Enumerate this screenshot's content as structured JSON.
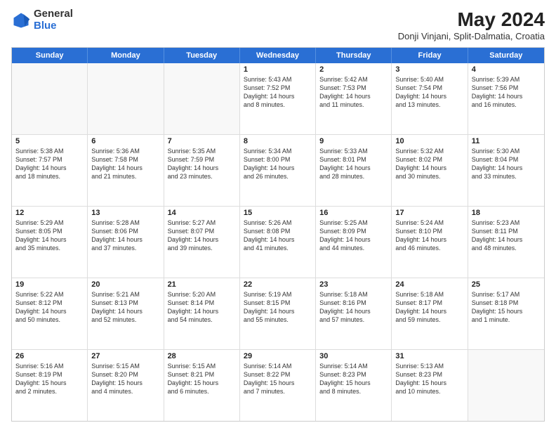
{
  "header": {
    "logo_general": "General",
    "logo_blue": "Blue",
    "month_year": "May 2024",
    "location": "Donji Vinjani, Split-Dalmatia, Croatia"
  },
  "days_of_week": [
    "Sunday",
    "Monday",
    "Tuesday",
    "Wednesday",
    "Thursday",
    "Friday",
    "Saturday"
  ],
  "weeks": [
    [
      {
        "day": "",
        "text": ""
      },
      {
        "day": "",
        "text": ""
      },
      {
        "day": "",
        "text": ""
      },
      {
        "day": "1",
        "text": "Sunrise: 5:43 AM\nSunset: 7:52 PM\nDaylight: 14 hours\nand 8 minutes."
      },
      {
        "day": "2",
        "text": "Sunrise: 5:42 AM\nSunset: 7:53 PM\nDaylight: 14 hours\nand 11 minutes."
      },
      {
        "day": "3",
        "text": "Sunrise: 5:40 AM\nSunset: 7:54 PM\nDaylight: 14 hours\nand 13 minutes."
      },
      {
        "day": "4",
        "text": "Sunrise: 5:39 AM\nSunset: 7:56 PM\nDaylight: 14 hours\nand 16 minutes."
      }
    ],
    [
      {
        "day": "5",
        "text": "Sunrise: 5:38 AM\nSunset: 7:57 PM\nDaylight: 14 hours\nand 18 minutes."
      },
      {
        "day": "6",
        "text": "Sunrise: 5:36 AM\nSunset: 7:58 PM\nDaylight: 14 hours\nand 21 minutes."
      },
      {
        "day": "7",
        "text": "Sunrise: 5:35 AM\nSunset: 7:59 PM\nDaylight: 14 hours\nand 23 minutes."
      },
      {
        "day": "8",
        "text": "Sunrise: 5:34 AM\nSunset: 8:00 PM\nDaylight: 14 hours\nand 26 minutes."
      },
      {
        "day": "9",
        "text": "Sunrise: 5:33 AM\nSunset: 8:01 PM\nDaylight: 14 hours\nand 28 minutes."
      },
      {
        "day": "10",
        "text": "Sunrise: 5:32 AM\nSunset: 8:02 PM\nDaylight: 14 hours\nand 30 minutes."
      },
      {
        "day": "11",
        "text": "Sunrise: 5:30 AM\nSunset: 8:04 PM\nDaylight: 14 hours\nand 33 minutes."
      }
    ],
    [
      {
        "day": "12",
        "text": "Sunrise: 5:29 AM\nSunset: 8:05 PM\nDaylight: 14 hours\nand 35 minutes."
      },
      {
        "day": "13",
        "text": "Sunrise: 5:28 AM\nSunset: 8:06 PM\nDaylight: 14 hours\nand 37 minutes."
      },
      {
        "day": "14",
        "text": "Sunrise: 5:27 AM\nSunset: 8:07 PM\nDaylight: 14 hours\nand 39 minutes."
      },
      {
        "day": "15",
        "text": "Sunrise: 5:26 AM\nSunset: 8:08 PM\nDaylight: 14 hours\nand 41 minutes."
      },
      {
        "day": "16",
        "text": "Sunrise: 5:25 AM\nSunset: 8:09 PM\nDaylight: 14 hours\nand 44 minutes."
      },
      {
        "day": "17",
        "text": "Sunrise: 5:24 AM\nSunset: 8:10 PM\nDaylight: 14 hours\nand 46 minutes."
      },
      {
        "day": "18",
        "text": "Sunrise: 5:23 AM\nSunset: 8:11 PM\nDaylight: 14 hours\nand 48 minutes."
      }
    ],
    [
      {
        "day": "19",
        "text": "Sunrise: 5:22 AM\nSunset: 8:12 PM\nDaylight: 14 hours\nand 50 minutes."
      },
      {
        "day": "20",
        "text": "Sunrise: 5:21 AM\nSunset: 8:13 PM\nDaylight: 14 hours\nand 52 minutes."
      },
      {
        "day": "21",
        "text": "Sunrise: 5:20 AM\nSunset: 8:14 PM\nDaylight: 14 hours\nand 54 minutes."
      },
      {
        "day": "22",
        "text": "Sunrise: 5:19 AM\nSunset: 8:15 PM\nDaylight: 14 hours\nand 55 minutes."
      },
      {
        "day": "23",
        "text": "Sunrise: 5:18 AM\nSunset: 8:16 PM\nDaylight: 14 hours\nand 57 minutes."
      },
      {
        "day": "24",
        "text": "Sunrise: 5:18 AM\nSunset: 8:17 PM\nDaylight: 14 hours\nand 59 minutes."
      },
      {
        "day": "25",
        "text": "Sunrise: 5:17 AM\nSunset: 8:18 PM\nDaylight: 15 hours\nand 1 minute."
      }
    ],
    [
      {
        "day": "26",
        "text": "Sunrise: 5:16 AM\nSunset: 8:19 PM\nDaylight: 15 hours\nand 2 minutes."
      },
      {
        "day": "27",
        "text": "Sunrise: 5:15 AM\nSunset: 8:20 PM\nDaylight: 15 hours\nand 4 minutes."
      },
      {
        "day": "28",
        "text": "Sunrise: 5:15 AM\nSunset: 8:21 PM\nDaylight: 15 hours\nand 6 minutes."
      },
      {
        "day": "29",
        "text": "Sunrise: 5:14 AM\nSunset: 8:22 PM\nDaylight: 15 hours\nand 7 minutes."
      },
      {
        "day": "30",
        "text": "Sunrise: 5:14 AM\nSunset: 8:23 PM\nDaylight: 15 hours\nand 8 minutes."
      },
      {
        "day": "31",
        "text": "Sunrise: 5:13 AM\nSunset: 8:23 PM\nDaylight: 15 hours\nand 10 minutes."
      },
      {
        "day": "",
        "text": ""
      }
    ]
  ]
}
